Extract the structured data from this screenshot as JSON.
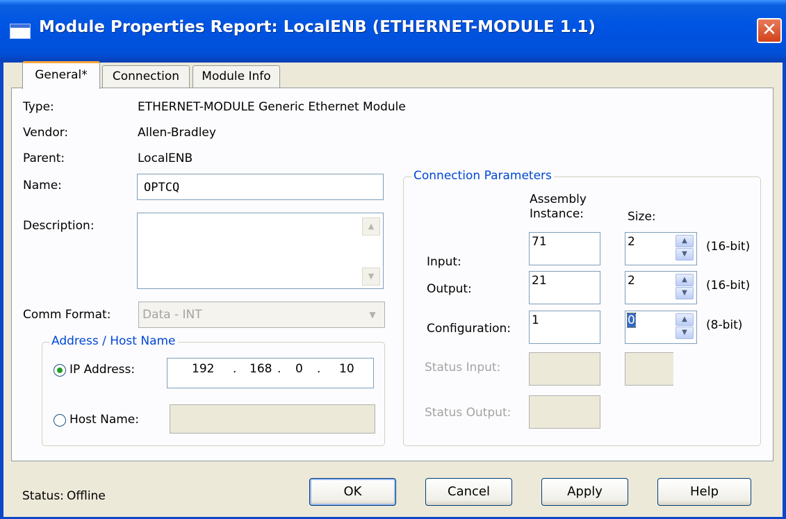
{
  "window": {
    "title": "Module Properties Report: LocalENB (ETHERNET-MODULE 1.1)",
    "close_glyph": "✕"
  },
  "tabs": [
    {
      "label": "General*"
    },
    {
      "label": "Connection"
    },
    {
      "label": "Module Info"
    }
  ],
  "general": {
    "type_label": "Type:",
    "type_value": "ETHERNET-MODULE Generic Ethernet Module",
    "vendor_label": "Vendor:",
    "vendor_value": "Allen-Bradley",
    "parent_label": "Parent:",
    "parent_value": "LocalENB",
    "name_label": "Name:",
    "name_value": "OPTCQ",
    "description_label": "Description:",
    "description_value": "",
    "comm_format_label": "Comm Format:",
    "comm_format_value": "Data - INT"
  },
  "address": {
    "group_title": "Address / Host Name",
    "ip_label": "IP Address:",
    "ip_octets": [
      "192",
      "168",
      "0",
      "10"
    ],
    "ip_dot": ".",
    "host_label": "Host Name:",
    "host_value": "",
    "selected": "ip"
  },
  "connection_params": {
    "group_title": "Connection Parameters",
    "col_assembly": "Assembly\nInstance:",
    "col_assembly_l1": "Assembly",
    "col_assembly_l2": "Instance:",
    "col_size": "Size:",
    "rows": [
      {
        "label": "Input:",
        "instance": "71",
        "size": "2",
        "unit": "(16-bit)"
      },
      {
        "label": "Output:",
        "instance": "21",
        "size": "2",
        "unit": "(16-bit)"
      },
      {
        "label": "Configuration:",
        "instance": "1",
        "size": "0",
        "unit": "(8-bit)"
      }
    ],
    "status_input_label": "Status Input:",
    "status_output_label": "Status Output:"
  },
  "footer": {
    "status_label": "Status:",
    "status_value": "Offline",
    "ok": "OK",
    "cancel": "Cancel",
    "apply": "Apply",
    "help": "Help"
  }
}
